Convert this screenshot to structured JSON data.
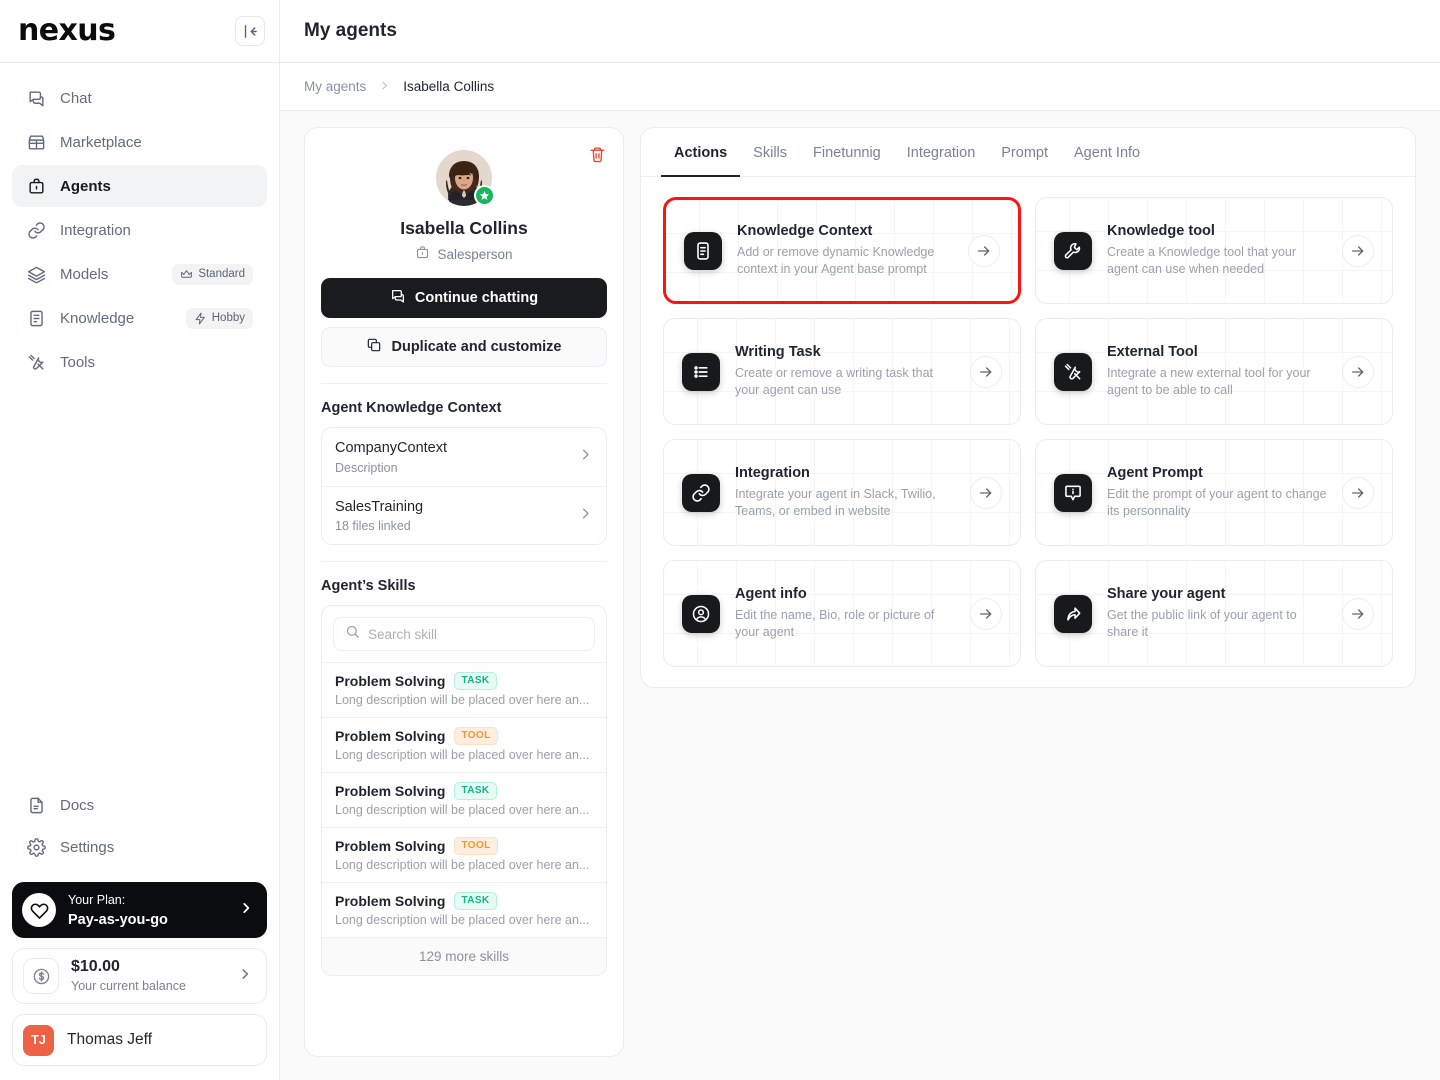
{
  "brand": {
    "logo_text": "nexus",
    "accent": "#ef6144",
    "dark": "#0b0c10"
  },
  "sidebar": {
    "collapse_icon": "collapse-sidebar-icon",
    "items": [
      {
        "label": "Chat",
        "icon": "chat-icon",
        "active": false,
        "chip": null
      },
      {
        "label": "Marketplace",
        "icon": "store-icon",
        "active": false,
        "chip": null
      },
      {
        "label": "Agents",
        "icon": "briefcase-icon",
        "active": true,
        "chip": null
      },
      {
        "label": "Integration",
        "icon": "link-icon",
        "active": false,
        "chip": null
      },
      {
        "label": "Models",
        "icon": "layers-icon",
        "active": false,
        "chip": {
          "label": "Standard",
          "icon": "crown-icon"
        }
      },
      {
        "label": "Knowledge",
        "icon": "document-icon",
        "active": false,
        "chip": {
          "label": "Hobby",
          "icon": "bolt-icon"
        }
      },
      {
        "label": "Tools",
        "icon": "tools-icon",
        "active": false,
        "chip": null
      }
    ],
    "footer_items": [
      {
        "label": "Docs",
        "icon": "file-icon"
      },
      {
        "label": "Settings",
        "icon": "gear-icon"
      }
    ],
    "plan_card": {
      "line1": "Your Plan:",
      "line2": "Pay-as-you-go",
      "icon": "heart-icon",
      "chevron": "chevron-right-icon"
    },
    "balance_card": {
      "amount": "$10.00",
      "caption": "Your current balance",
      "icon": "dollar-circle-icon",
      "chevron": "chevron-right-icon"
    },
    "user_card": {
      "initials": "TJ",
      "name": "Thomas Jeff"
    }
  },
  "header": {
    "title": "My agents"
  },
  "breadcrumb": {
    "root": "My agents",
    "separator": "›",
    "current": "Isabella Collins"
  },
  "agent": {
    "name": "Isabella Collins",
    "role": "Salesperson",
    "role_icon": "briefcase-icon",
    "verified_icon": "star-badge-icon",
    "delete_icon": "trash-icon",
    "delete_color": "#e8422e",
    "primary_button": {
      "label": "Continue chatting",
      "icon": "chat-icon"
    },
    "secondary_button": {
      "label": "Duplicate and customize",
      "icon": "copy-icon"
    }
  },
  "knowledge_context": {
    "title": "Agent Knowledge Context",
    "items": [
      {
        "name": "CompanyContext",
        "sub": "Description",
        "chevron": "chevron-right-icon"
      },
      {
        "name": "SalesTraining",
        "sub": "18 files linked",
        "chevron": "chevron-right-icon"
      }
    ]
  },
  "skills": {
    "title": "Agent’s Skills",
    "search": {
      "placeholder": "Search skill",
      "value": "",
      "icon": "search-icon"
    },
    "items": [
      {
        "name": "Problem Solving",
        "badge": "TASK",
        "badge_type": "task",
        "desc": "Long description will be placed over here an..."
      },
      {
        "name": "Problem Solving",
        "badge": "TOOL",
        "badge_type": "tool",
        "desc": "Long description will be placed over here an..."
      },
      {
        "name": "Problem Solving",
        "badge": "TASK",
        "badge_type": "task",
        "desc": "Long description will be placed over here an..."
      },
      {
        "name": "Problem Solving",
        "badge": "TOOL",
        "badge_type": "tool",
        "desc": "Long description will be placed over here an..."
      },
      {
        "name": "Problem Solving",
        "badge": "TASK",
        "badge_type": "task",
        "desc": "Long description will be placed over here an..."
      }
    ],
    "more_label": "129 more skills"
  },
  "tabs": [
    {
      "label": "Actions",
      "active": true
    },
    {
      "label": "Skills",
      "active": false
    },
    {
      "label": "Finetunnig",
      "active": false
    },
    {
      "label": "Integration",
      "active": false
    },
    {
      "label": "Prompt",
      "active": false
    },
    {
      "label": "Agent Info",
      "active": false
    }
  ],
  "action_cards": [
    {
      "title": "Knowledge Context",
      "desc": "Add or remove dynamic Knowledge context in your Agent base prompt",
      "icon": "knowledge-document-icon",
      "highlighted": true,
      "arrow": "arrow-right-icon"
    },
    {
      "title": "Knowledge tool",
      "desc": "Create a Knowledge tool that your agent can use when needed",
      "icon": "wrench-icon",
      "highlighted": false,
      "arrow": "arrow-right-icon"
    },
    {
      "title": "Writing Task",
      "desc": "Create or remove a writing task that your agent can use",
      "icon": "list-icon",
      "highlighted": false,
      "arrow": "arrow-right-icon"
    },
    {
      "title": "External Tool",
      "desc": "Integrate a new external tool for your agent to be able to call",
      "icon": "tools-icon",
      "highlighted": false,
      "arrow": "arrow-right-icon"
    },
    {
      "title": "Integration",
      "desc": "Integrate your agent in Slack, Twilio, Teams, or embed in website",
      "icon": "link-icon",
      "highlighted": false,
      "arrow": "arrow-right-icon"
    },
    {
      "title": "Agent Prompt",
      "desc": "Edit the prompt of your agent to change its personnality",
      "icon": "prompt-bubble-icon",
      "highlighted": false,
      "arrow": "arrow-right-icon"
    },
    {
      "title": "Agent info",
      "desc": "Edit the name, Bio, role or picture of your agent",
      "icon": "user-circle-icon",
      "highlighted": false,
      "arrow": "arrow-right-icon"
    },
    {
      "title": "Share your agent",
      "desc": "Get the public link of your agent to share it",
      "icon": "share-arrow-icon",
      "highlighted": false,
      "arrow": "arrow-right-icon"
    }
  ]
}
